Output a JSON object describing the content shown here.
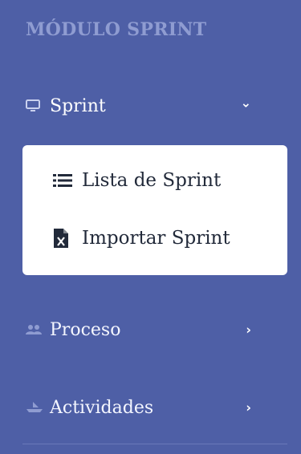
{
  "sidebar": {
    "heading": "MÓDULO SPRINT",
    "items": [
      {
        "label": "Sprint",
        "icon": "monitor-icon",
        "chevron": "⌄",
        "expanded": true
      },
      {
        "label": "Proceso",
        "icon": "users-icon",
        "chevron": "›"
      },
      {
        "label": "Actividades",
        "icon": "ship-icon",
        "chevron": "›"
      }
    ],
    "submenu": [
      {
        "label": "Lista de Sprint",
        "icon": "list-icon"
      },
      {
        "label": "Importar Sprint",
        "icon": "excel-file-icon"
      }
    ]
  },
  "colors": {
    "sidebar_bg": "#4e5fa6",
    "heading": "#8f9cd1",
    "submenu_bg": "#ffffff",
    "submenu_text": "#222a3a"
  }
}
